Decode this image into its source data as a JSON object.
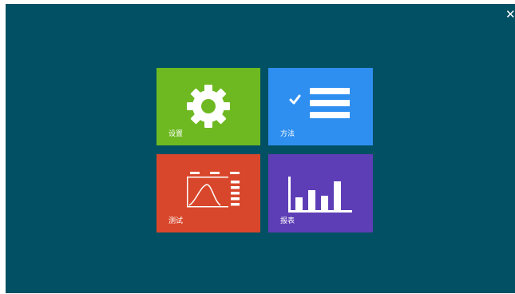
{
  "window": {
    "close_glyph": "✕"
  },
  "tiles": [
    {
      "label": "设置",
      "icon": "gear-icon",
      "color": "#6eb921"
    },
    {
      "label": "方法",
      "icon": "checklist-icon",
      "color": "#2e8ff0"
    },
    {
      "label": "测试",
      "icon": "test-curve-icon",
      "color": "#d8472b"
    },
    {
      "label": "报表",
      "icon": "bar-chart-icon",
      "color": "#5e3eb6"
    }
  ],
  "colors": {
    "background": "#025063",
    "icon_white": "#ffffff"
  }
}
